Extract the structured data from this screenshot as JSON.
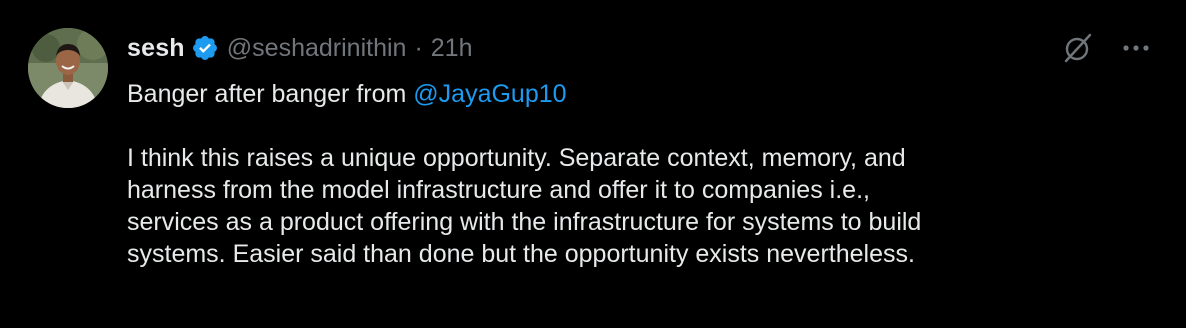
{
  "tweet": {
    "display_name": "sesh",
    "handle": "@seshadrinithin",
    "separator": "·",
    "timestamp": "21h",
    "line1_prefix": "Banger after banger from ",
    "mention": "@JayaGup10",
    "paragraph_lines": [
      "I think this raises a unique opportunity.  Separate context, memory, and",
      "harness from the model infrastructure and offer it to companies i.e.,",
      "services as a product offering with the infrastructure for systems to build",
      "systems. Easier said than done but the opportunity exists nevertheless."
    ]
  },
  "icons": {
    "verified": "verified-badge-icon",
    "grok": "grok-icon",
    "more": "more-icon"
  },
  "colors": {
    "background": "#000000",
    "text": "#e7e9ea",
    "muted": "#71767b",
    "link": "#1d9bf0",
    "verified": "#1d9bf0"
  }
}
